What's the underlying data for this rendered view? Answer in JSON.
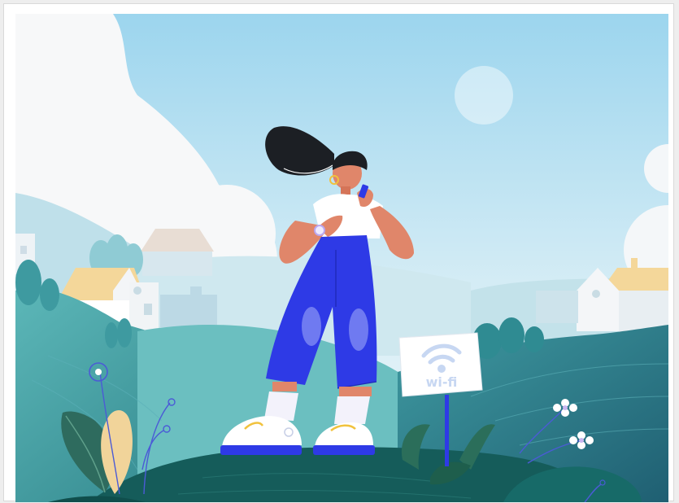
{
  "illustration": {
    "sign_text": "wi-fi",
    "colors": {
      "sky_top": "#9fd6ee",
      "sky_bottom": "#e6f3f8",
      "hill_teal": "#4fa6ad",
      "hill_dark": "#1f6b6b",
      "ground": "#155c5a",
      "pants_blue": "#2e3ae6",
      "skin": "#e0866a",
      "hair": "#1c1f24",
      "roof_yellow": "#f4d79a",
      "sign_icon": "#c9d8f4"
    }
  }
}
